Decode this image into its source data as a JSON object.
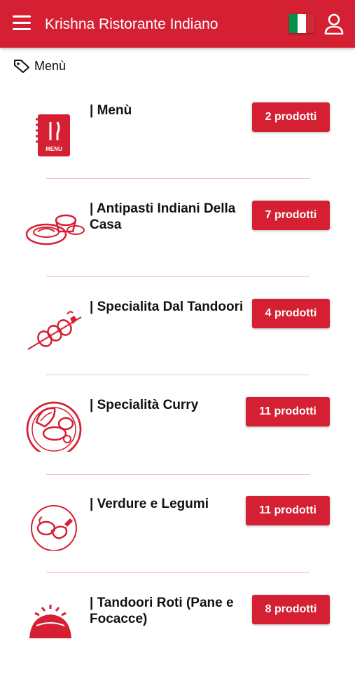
{
  "app": {
    "title": "Krishna Ristorante Indiano"
  },
  "breadcrumb": {
    "label": "Menù"
  },
  "colors": {
    "primary": "#d42032",
    "flag": [
      "#009246",
      "#ffffff",
      "#ce2b37"
    ]
  },
  "categories": [
    {
      "name": "| Menù",
      "count": "2 prodotti",
      "icon": "menu-book-icon"
    },
    {
      "name": "| Antipasti Indiani Della Casa",
      "count": "7 prodotti",
      "icon": "appetizer-dishes-icon"
    },
    {
      "name": "| Specialita Dal Tandoori",
      "count": "4 prodotti",
      "icon": "skewer-icon"
    },
    {
      "name": "| Specialità Curry",
      "count": "11 prodotti",
      "icon": "curry-plate-icon"
    },
    {
      "name": "| Verdure e Legumi",
      "count": "11 prodotti",
      "icon": "vegetables-icon"
    },
    {
      "name": "| Tandoori Roti (Pane e Focacce)",
      "count": "8 prodotti",
      "icon": "tandoor-bread-icon"
    }
  ]
}
